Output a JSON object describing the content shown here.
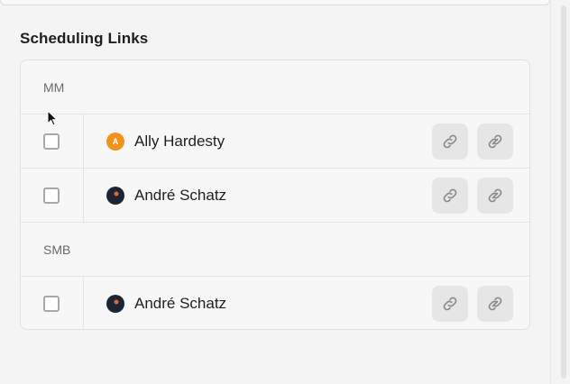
{
  "section": {
    "title": "Scheduling Links"
  },
  "groups": [
    {
      "label": "MM",
      "people": [
        {
          "name": "Ally Hardesty",
          "avatar_initial": "A",
          "avatar_type": "initial",
          "avatar_color": "#f0921c"
        },
        {
          "name": "André Schatz",
          "avatar_type": "photo"
        }
      ]
    },
    {
      "label": "SMB",
      "people": [
        {
          "name": "André Schatz",
          "avatar_type": "photo"
        }
      ]
    }
  ],
  "icons": {
    "copy_link": "link-icon",
    "open_link": "link-arrow-icon"
  }
}
